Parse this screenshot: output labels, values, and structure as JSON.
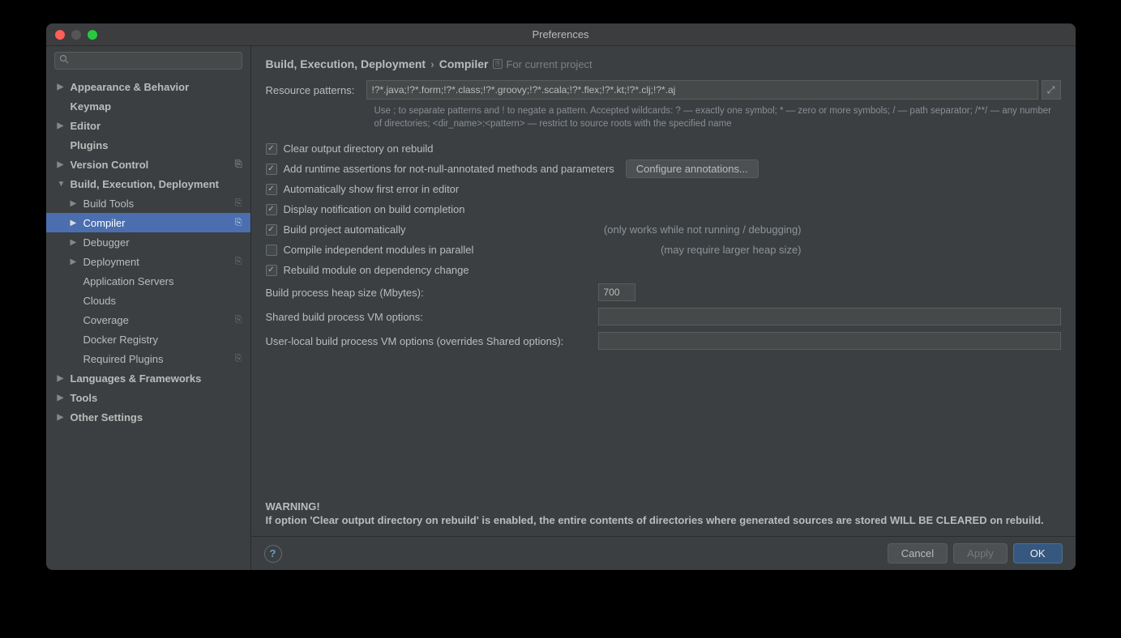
{
  "window": {
    "title": "Preferences"
  },
  "search": {
    "placeholder": ""
  },
  "tree": [
    {
      "label": "Appearance & Behavior",
      "indent": 0,
      "bold": true,
      "expander": "▶"
    },
    {
      "label": "Keymap",
      "indent": 0,
      "bold": true
    },
    {
      "label": "Editor",
      "indent": 0,
      "bold": true,
      "expander": "▶"
    },
    {
      "label": "Plugins",
      "indent": 0,
      "bold": true
    },
    {
      "label": "Version Control",
      "indent": 0,
      "bold": true,
      "expander": "▶",
      "badge": "⎘"
    },
    {
      "label": "Build, Execution, Deployment",
      "indent": 0,
      "bold": true,
      "expander": "▼"
    },
    {
      "label": "Build Tools",
      "indent": 1,
      "expander": "▶",
      "badge": "⎘"
    },
    {
      "label": "Compiler",
      "indent": 1,
      "expander": "▶",
      "selected": true,
      "badge": "⎘"
    },
    {
      "label": "Debugger",
      "indent": 1,
      "expander": "▶"
    },
    {
      "label": "Deployment",
      "indent": 1,
      "expander": "▶",
      "badge": "⎘"
    },
    {
      "label": "Application Servers",
      "indent": 1
    },
    {
      "label": "Clouds",
      "indent": 1
    },
    {
      "label": "Coverage",
      "indent": 1,
      "badge": "⎘"
    },
    {
      "label": "Docker Registry",
      "indent": 1
    },
    {
      "label": "Required Plugins",
      "indent": 1,
      "badge": "⎘"
    },
    {
      "label": "Languages & Frameworks",
      "indent": 0,
      "bold": true,
      "expander": "▶"
    },
    {
      "label": "Tools",
      "indent": 0,
      "bold": true,
      "expander": "▶"
    },
    {
      "label": "Other Settings",
      "indent": 0,
      "bold": true,
      "expander": "▶"
    }
  ],
  "breadcrumb": {
    "part1": "Build, Execution, Deployment",
    "sep": "›",
    "part2": "Compiler",
    "scope": "For current project"
  },
  "resource": {
    "label": "Resource patterns:",
    "value": "!?*.java;!?*.form;!?*.class;!?*.groovy;!?*.scala;!?*.flex;!?*.kt;!?*.clj;!?*.aj",
    "help": "Use ; to separate patterns and ! to negate a pattern. Accepted wildcards: ? — exactly one symbol; * — zero or more symbols; / — path separator; /**/ — any number of directories; <dir_name>:<pattern> — restrict to source roots with the specified name"
  },
  "checks": {
    "clear": {
      "label": "Clear output directory on rebuild",
      "checked": true
    },
    "assert": {
      "label": "Add runtime assertions for not-null-annotated methods and parameters",
      "checked": true,
      "btn": "Configure annotations..."
    },
    "auto_err": {
      "label": "Automatically show first error in editor",
      "checked": true
    },
    "notify": {
      "label": "Display notification on build completion",
      "checked": true
    },
    "auto_build": {
      "label": "Build project automatically",
      "checked": true,
      "note": "(only works while not running / debugging)"
    },
    "parallel": {
      "label": "Compile independent modules in parallel",
      "checked": false,
      "note": "(may require larger heap size)"
    },
    "rebuild_dep": {
      "label": "Rebuild module on dependency change",
      "checked": true
    }
  },
  "fields": {
    "heap": {
      "label": "Build process heap size (Mbytes):",
      "value": "700"
    },
    "shared_vm": {
      "label": "Shared build process VM options:",
      "value": ""
    },
    "local_vm": {
      "label": "User-local build process VM options (overrides Shared options):",
      "value": ""
    }
  },
  "warning": {
    "l1": "WARNING!",
    "l2": "If option 'Clear output directory on rebuild' is enabled, the entire contents of directories where generated sources are stored WILL BE CLEARED on rebuild."
  },
  "footer": {
    "cancel": "Cancel",
    "apply": "Apply",
    "ok": "OK"
  }
}
